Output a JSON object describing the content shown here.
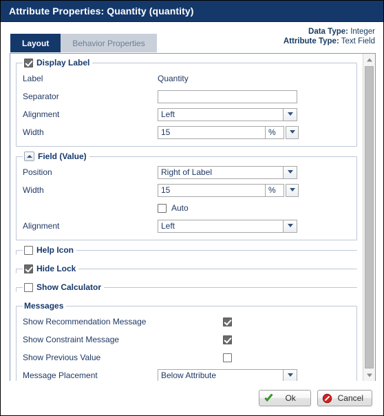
{
  "window": {
    "title": "Attribute Properties: Quantity (quantity)"
  },
  "header": {
    "data_type_key": "Data Type:",
    "data_type_value": "Integer",
    "attribute_type_key": "Attribute Type:",
    "attribute_type_value": "Text Field",
    "tabs": [
      {
        "label": "Layout",
        "active": true
      },
      {
        "label": "Behavior Properties",
        "active": false
      }
    ]
  },
  "display_label": {
    "group_label": "Display Label",
    "checked": true,
    "rows": {
      "label_caption": "Label",
      "label_value": "Quantity",
      "separator_caption": "Separator",
      "separator_value": "",
      "separator_placeholder": "",
      "alignment_caption": "Alignment",
      "alignment_value": "Left",
      "width_caption": "Width",
      "width_value": "15",
      "width_unit": "%"
    }
  },
  "field_value": {
    "group_label": "Field (Value)",
    "collapse_icon": "collapse-up-icon",
    "rows": {
      "position_caption": "Position",
      "position_value": "Right of Label",
      "width_caption": "Width",
      "width_value": "15",
      "width_unit": "%",
      "auto_caption": "Auto",
      "auto_checked": false,
      "alignment_caption": "Alignment",
      "alignment_value": "Left"
    }
  },
  "toggles": [
    {
      "label": "Help Icon",
      "checked": false
    },
    {
      "label": "Hide Lock",
      "checked": true
    },
    {
      "label": "Show Calculator",
      "checked": false
    }
  ],
  "messages": {
    "group_label": "Messages",
    "rows": [
      {
        "caption": "Show Recommendation Message",
        "checked": true
      },
      {
        "caption": "Show Constraint Message",
        "checked": true
      },
      {
        "caption": "Show Previous Value",
        "checked": false
      }
    ],
    "placement_caption": "Message Placement",
    "placement_value": "Below Attribute"
  },
  "scrollbar": {
    "up_icon": "scroll-up-icon",
    "down_icon": "scroll-down-icon"
  },
  "footer": {
    "ok_label": "Ok",
    "ok_icon": "green-check-icon",
    "cancel_label": "Cancel",
    "cancel_icon": "red-prohibition-icon"
  },
  "colors": {
    "titlebar": "#15386b",
    "tab_active": "#15386b",
    "tab_inactive": "#c9d0da",
    "panel_border": "#7f99bb",
    "group_border": "#bcc6d6",
    "text": "#1f3864",
    "ok_icon": "#36a425",
    "cancel_icon": "#cc2222"
  }
}
